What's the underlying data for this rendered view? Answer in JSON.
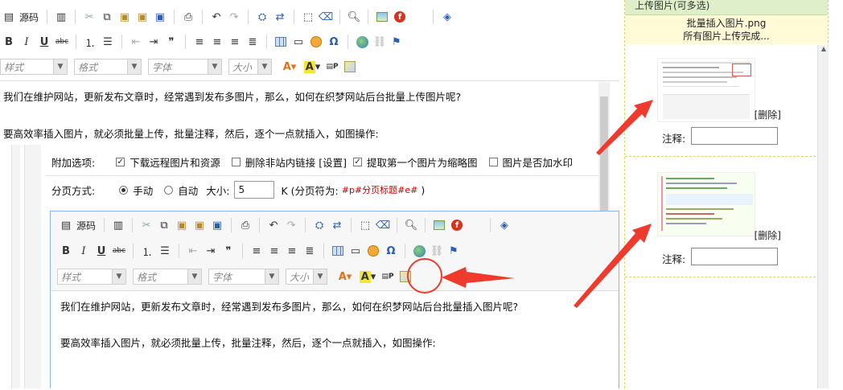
{
  "toolbar": {
    "source_label": "源码",
    "style_placeholder": "样式",
    "format_placeholder": "格式",
    "font_placeholder": "字体",
    "size_placeholder": "大小",
    "bold": "B",
    "italic": "I",
    "underline": "U",
    "strike": "abc",
    "quote": "❞",
    "omega": "Ω",
    "undo": "↶",
    "redo": "↷"
  },
  "document": {
    "para1": "我们在维护网站，更新发布文章时，经常遇到发布多图片，那么，如何在织梦网站后台批量上传图片呢?",
    "para2": "要高效率插入图片，就必须批量上传，批量注释，然后，逐个一点就插入，如图操作:"
  },
  "options": {
    "label": "附加选项:",
    "download_remote": "下载远程图片和资源",
    "remove_links": "删除非站内链接",
    "settings": "[设置]",
    "first_thumb": "提取第一个图片为缩略图",
    "watermark": "图片是否加水印"
  },
  "paging": {
    "label": "分页方式:",
    "manual": "手动",
    "auto": "自动",
    "size_label": "大小:",
    "size_value": "5",
    "unit_prefix": "K (分页符为:",
    "separator": "#p#分页标题#e#",
    "unit_suffix": ")"
  },
  "inner_document": {
    "para1": "我们在维护网站，更新发布文章时，经常遇到发布多图片，那么，如何在织梦网站后台批量插入图片呢?",
    "para2": "要高效率插入图片，就必须批量上传，批量注释，然后，逐个一点就插入，如图操作:"
  },
  "upload_panel": {
    "title": "上传图片(可多选)",
    "status_line1": "批量插入图片.png",
    "status_line2": "所有图片上传完成...",
    "items": [
      {
        "delete": "[删除]",
        "note_label": "注释:"
      },
      {
        "delete": "[删除]",
        "note_label": "注释:"
      }
    ]
  },
  "colors": {
    "separator_red": "#cc0000",
    "annotation_red": "#ee3b2e",
    "panel_header": "#dfefc9",
    "status_bg": "#fffbd6",
    "editor_border": "#8fb4e0"
  }
}
